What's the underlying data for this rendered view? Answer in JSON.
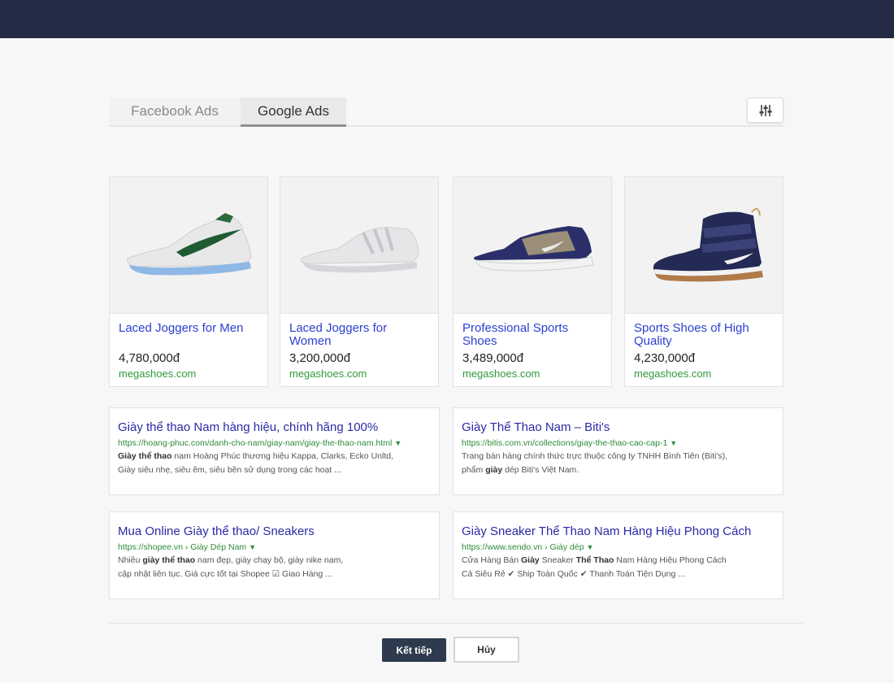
{
  "tabs": [
    {
      "label": "Facebook Ads",
      "active": false
    },
    {
      "label": "Google Ads",
      "active": true
    }
  ],
  "filter": {
    "icon": "sliders-icon"
  },
  "products": [
    {
      "title": "Laced Joggers for Men",
      "price": "4,780,000đ",
      "domain": "megashoes.com",
      "image": "sneaker-white-green"
    },
    {
      "title": "Laced Joggers for Women",
      "price": "3,200,000đ",
      "domain": "megashoes.com",
      "image": "sneaker-white"
    },
    {
      "title": "Professional Sports Shoes",
      "price": "3,489,000đ",
      "domain": "megashoes.com",
      "image": "sneaker-navy"
    },
    {
      "title": "Sports Shoes of High Quality",
      "price": "4,230,000đ",
      "domain": "megashoes.com",
      "image": "hightop-navy"
    }
  ],
  "ads": [
    {
      "title": "Giày thể thao Nam hàng hiệu, chính hãng 100%",
      "url": "https://hoang-phuc.com/danh-cho-nam/giay-nam/giay-the-thao-nam.html",
      "desc1_bold": "Giày thể thao",
      "desc1_rest": " nam Hoàng Phúc thương hiệu Kappa, Clarks, Ecko Unltd,",
      "desc2": "Giày siêu nhẹ, siêu êm, siêu bền sử dụng trong các hoạt ..."
    },
    {
      "title": "Giày Thể Thao Nam – Biti's",
      "url": "https://bitis.com.vn/collections/giay-the-thao-cao-cap-1",
      "desc1_bold": "",
      "desc1_rest": "Trang bán hàng chính thức trực thuộc công ty TNHH Bình Tiên (Biti's),",
      "desc2_pre": "phẩm ",
      "desc2_bold": "giày",
      "desc2_post": " dép Biti's Việt Nam."
    },
    {
      "title": "Mua Online Giày thể thao/ Sneakers",
      "url": "https://shopee.vn › Giày Dép Nam",
      "desc1_pre": "Nhiều ",
      "desc1_bold": "giày thể thao",
      "desc1_rest": " nam đẹp, giày chạy bộ, giày nike nam,",
      "desc2": "cập nhật liên tục. Giá cực tốt tại Shopee ☑ Giao Hàng ..."
    },
    {
      "title": "Giày Sneaker Thể Thao Nam Hàng Hiệu Phong Cách",
      "url": "https://www.sendo.vn › Giày dép",
      "desc1_pre": "Cửa Hàng Bán ",
      "desc1_bold": "Giày",
      "desc1_mid": " Sneaker ",
      "desc1_bold2": "Thể Thao",
      "desc1_rest": " Nam Hàng Hiệu Phong Cách",
      "desc2": "Cả Siêu Rẻ ✔ Ship Toàn Quốc ✔ Thanh Toán Tiện Dụng ..."
    }
  ],
  "buttons": {
    "next": "Kết tiếp",
    "cancel": "Hủy"
  },
  "colors": {
    "topbar": "#232b45",
    "link": "#2a3fd0",
    "url": "#2e9a3a",
    "primary_button": "#2e3b4e"
  }
}
